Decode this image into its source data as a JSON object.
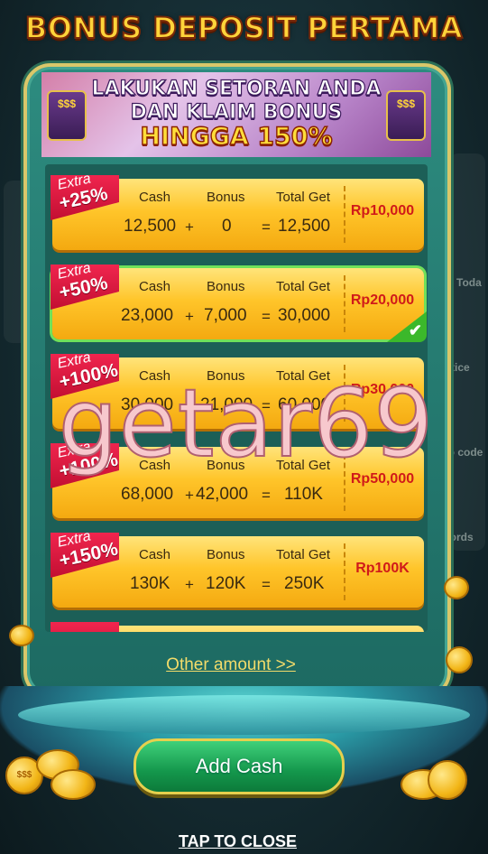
{
  "title": "BONUS DEPOSIT PERTAMA",
  "banner": {
    "line1": "LAKUKAN SETORAN ANDA",
    "line2": "DAN KLAIM BONUS",
    "line3": "HINGGA 150%",
    "deco_icon": "slot-machine-icon",
    "deco_text": "$$$"
  },
  "headers": {
    "cash": "Cash",
    "bonus": "Bonus",
    "total": "Total Get",
    "plus": "+",
    "equals": "="
  },
  "extra_word": "Extra",
  "packages": [
    {
      "extra": "+25%",
      "cash": "12,500",
      "bonus": "0",
      "total": "12,500",
      "price": "Rp10,000",
      "selected": false
    },
    {
      "extra": "+50%",
      "cash": "23,000",
      "bonus": "7,000",
      "total": "30,000",
      "price": "Rp20,000",
      "selected": true
    },
    {
      "extra": "+100%",
      "cash": "30,000",
      "bonus": "21,000",
      "total": "60,000",
      "price": "Rp30,000",
      "selected": false
    },
    {
      "extra": "+100%",
      "cash": "68,000",
      "bonus": "42,000",
      "total": "110K",
      "price": "Rp50,000",
      "selected": false
    },
    {
      "extra": "+150%",
      "cash": "130K",
      "bonus": "120K",
      "total": "250K",
      "price": "Rp100K",
      "selected": false
    }
  ],
  "check_glyph": "✔",
  "other_amount": "Other amount >>",
  "add_cash": "Add Cash",
  "tap_to_close": "TAP TO CLOSE",
  "watermark": "getar69",
  "background_labels": {
    "today": "s Toda",
    "notice": "tice",
    "promo_code": "mo code",
    "records": "cords"
  },
  "colors": {
    "title": "#ffd43a",
    "card": "#ffc52a",
    "extra_tab": "#e0173f",
    "price": "#d01a1a",
    "button": "#14974c",
    "selected_border": "#6fe05a"
  }
}
